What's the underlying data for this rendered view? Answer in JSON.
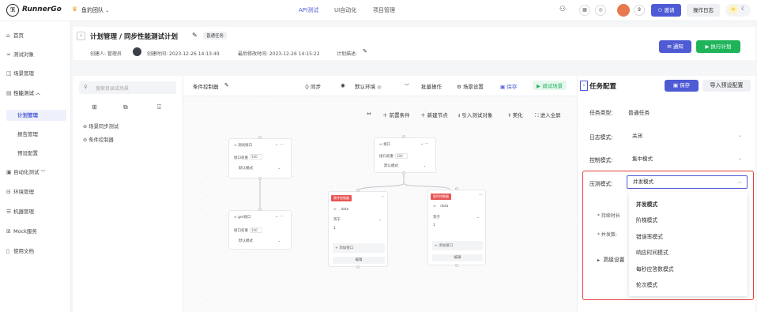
{
  "topbar": {
    "logo": "RunnerGo",
    "team": "鱼豹团队",
    "nav": [
      "API测试",
      "UI自动化",
      "项目管理"
    ],
    "badge_count": "9",
    "invite_label": "邀请",
    "oplog_label": "操作日志"
  },
  "sidebar": {
    "items": [
      {
        "label": "首页",
        "icon": "home-icon"
      },
      {
        "label": "测试对象",
        "icon": "link-icon"
      },
      {
        "label": "场景管理",
        "icon": "scene-icon"
      },
      {
        "label": "性能测试",
        "icon": "doc-icon"
      },
      {
        "label": "计划管理"
      },
      {
        "label": "报告管理"
      },
      {
        "label": "预设配置"
      },
      {
        "label": "自动化测试",
        "icon": "auto-icon"
      },
      {
        "label": "环境管理",
        "icon": "env-icon"
      },
      {
        "label": "机器管理",
        "icon": "machine-icon"
      },
      {
        "label": "Mock服务",
        "icon": "mock-icon"
      },
      {
        "label": "使用文档",
        "icon": "book-icon"
      }
    ]
  },
  "header": {
    "title": "计划管理 / 同步性能测试计划",
    "tag": "普通任务",
    "creator": "创建人: 管理员",
    "created": "创建时间: 2023-12-26 14:13:49",
    "updated": "最后修改时间: 2023-12-26 14:15:22",
    "desc_label": "计划描述:",
    "notify_label": "通知",
    "run_label": "执行计划"
  },
  "tree": {
    "search_placeholder": "搜索目录或场景",
    "items": [
      "场景同步测试",
      "条件控制器"
    ]
  },
  "canvas_toolbar": {
    "name": "条件控制器",
    "sync": "同步",
    "env": "默认环境",
    "batch": "批量操作",
    "scene_settings": "场景设置",
    "save": "保存",
    "debug": "调试场景"
  },
  "canvas_actions": {
    "pre": "前置条件",
    "add_node": "新建节点",
    "import": "引入测试对象",
    "beautify": "美化",
    "fullscreen": "进入全屏"
  },
  "nodes": {
    "api1_name": "测试接口",
    "api2_name": "接口",
    "api3_name": "get接口",
    "weight_label": "接口权重",
    "weight": "100",
    "mode": "默认模式",
    "cond_tag": "条件控制器",
    "var": "data",
    "op": "等于",
    "val": "1",
    "add_api": "+ 添加接口",
    "edit": "编辑"
  },
  "right": {
    "title": "任务配置",
    "save_label": "保存",
    "import_label": "导入预设配置",
    "task_type_label": "任务类型:",
    "task_type": "普通任务",
    "log_mode_label": "日志模式:",
    "log_mode": "关闭",
    "control_mode_label": "控制模式:",
    "control_mode": "集中模式",
    "pressure_mode_label": "压测模式:",
    "pressure_mode": "并发模式",
    "duration_label": "* 持续时长",
    "concurrency_label": "* 并发数:",
    "advanced_label": "高级设置",
    "options": [
      "并发模式",
      "阶梯模式",
      "错误率模式",
      "响应时间模式",
      "每秒应答数模式",
      "轮次模式"
    ]
  },
  "colors": {
    "accent": "#4f5bd5",
    "success": "#1fb45a",
    "danger": "#e23c3c"
  }
}
